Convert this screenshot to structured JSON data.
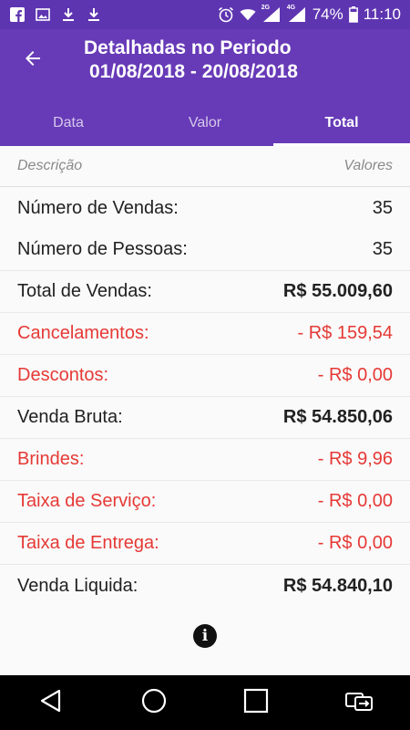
{
  "status_bar": {
    "battery": "74%",
    "time": "11:10",
    "signal_1": "2G",
    "signal_2": "4G",
    "icons": [
      "facebook-icon",
      "image-icon",
      "download-icon",
      "download-icon",
      "alarm-icon",
      "wifi-icon",
      "signal-icon",
      "signal-icon",
      "battery-icon"
    ]
  },
  "app_bar": {
    "title_line1": "Detalhadas no Periodo",
    "title_line2": "01/08/2018 - 20/08/2018",
    "back_icon": "arrow-left-icon",
    "color": "#673ab7"
  },
  "tabs": [
    {
      "label": "Data",
      "active": false
    },
    {
      "label": "Valor",
      "active": false
    },
    {
      "label": "Total",
      "active": true
    }
  ],
  "table": {
    "header_left": "Descrição",
    "header_right": "Valores",
    "rows": [
      {
        "label": "Número de Vendas:",
        "value": "35",
        "style": "normal"
      },
      {
        "label": "Número de Pessoas:",
        "value": "35",
        "style": "normal"
      },
      {
        "label": "Total de Vendas:",
        "value": "R$ 55.009,60",
        "style": "bold"
      },
      {
        "label": "Cancelamentos:",
        "value": "- R$ 159,54",
        "style": "red"
      },
      {
        "label": "Descontos:",
        "value": "- R$ 0,00",
        "style": "red"
      },
      {
        "label": "Venda Bruta:",
        "value": "R$ 54.850,06",
        "style": "bold"
      },
      {
        "label": "Brindes:",
        "value": "- R$ 9,96",
        "style": "red"
      },
      {
        "label": "Taixa de Serviço:",
        "value": "- R$ 0,00",
        "style": "red"
      },
      {
        "label": "Taixa de Entrega:",
        "value": "- R$ 0,00",
        "style": "red"
      },
      {
        "label": "Venda Liquida:",
        "value": "R$ 54.840,10",
        "style": "bold"
      }
    ]
  },
  "info_icon": "info-icon",
  "nav_bar": [
    "back-triangle-icon",
    "home-circle-icon",
    "recents-square-icon",
    "switch-sim-icon"
  ],
  "colors": {
    "accent": "#673ab7",
    "status": "#5e35b1",
    "negative": "#e53935"
  }
}
